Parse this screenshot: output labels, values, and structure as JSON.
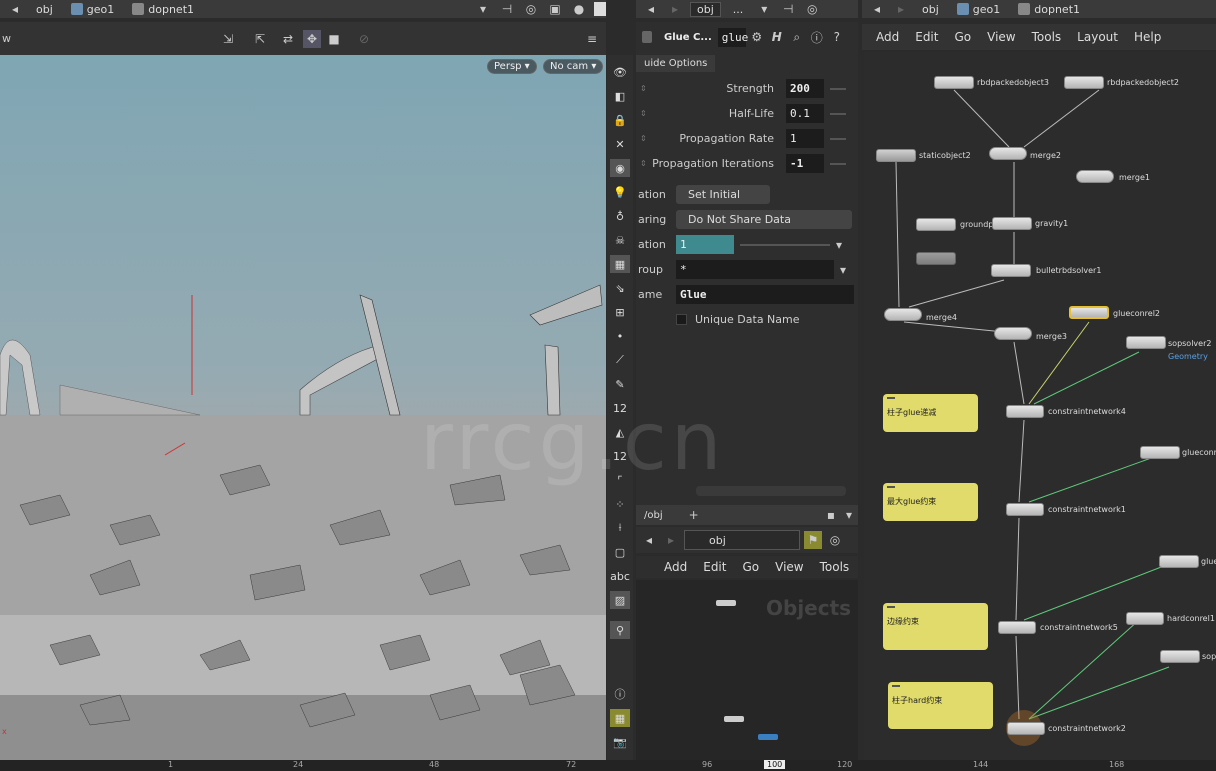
{
  "viewport_pane": {
    "path": [
      "obj",
      "geo1",
      "dopnet1"
    ],
    "camera_button": "Persp ▾",
    "cam_button": "No cam ▾",
    "side_toolbar_labels": [
      "12",
      "12",
      "abc"
    ]
  },
  "parm_pane": {
    "path": [
      "obj",
      "..."
    ],
    "node_type": "Glue C...",
    "node_name": "glue",
    "tab": "uide Options",
    "params": [
      {
        "label": "Strength",
        "value": "200"
      },
      {
        "label": "Half-Life",
        "value": "0.1"
      },
      {
        "label": "Propagation Rate",
        "value": "1"
      },
      {
        "label": "Propagation Iterations",
        "value": "-1"
      }
    ],
    "rows": [
      {
        "label": "ation",
        "value": "Set Initial"
      },
      {
        "label": "aring",
        "value": "Do Not Share Data"
      },
      {
        "label": "ation",
        "value": "1"
      },
      {
        "label": "roup",
        "value": "*"
      },
      {
        "label": "ame",
        "value": "Glue"
      }
    ],
    "unique_data_name": "Unique Data Name"
  },
  "obj_pane": {
    "tab": "/obj",
    "path": "obj",
    "menu": [
      "Add",
      "Edit",
      "Go",
      "View",
      "Tools"
    ],
    "watermark": "Objects"
  },
  "network_pane": {
    "path": [
      "obj",
      "geo1",
      "dopnet1"
    ],
    "menu": [
      "Add",
      "Edit",
      "Go",
      "View",
      "Tools",
      "Layout",
      "Help"
    ],
    "nodes": [
      {
        "name": "rbdpackedobject3"
      },
      {
        "name": "rbdpackedobject2"
      },
      {
        "name": "staticobject2"
      },
      {
        "name": "merge2"
      },
      {
        "name": "merge1"
      },
      {
        "name": "groundpl"
      },
      {
        "name": "gravity1"
      },
      {
        "name": "bulletrbdsolver1"
      },
      {
        "name": "merge4"
      },
      {
        "name": "merge3"
      },
      {
        "name": "glueconrel2"
      },
      {
        "name": "sopsolver2"
      },
      {
        "name": "constraintnetwork4"
      },
      {
        "name": "glueconre"
      },
      {
        "name": "constraintnetwork1"
      },
      {
        "name": "glue"
      },
      {
        "name": "hardconrel1"
      },
      {
        "name": "constraintnetwork5"
      },
      {
        "name": "sop"
      },
      {
        "name": "constraintnetwork2"
      }
    ],
    "sopsolver_sub": "Geometry",
    "stickies": [
      "柱子glue递减",
      "最大glue约束",
      "边缘约束",
      "柱子hard约束"
    ]
  },
  "timeline": {
    "ticks": [
      "1",
      "24",
      "48",
      "72",
      "96",
      "100",
      "120",
      "144",
      "168"
    ],
    "current_frame": "100"
  },
  "watermark_text": "rrcg.cn"
}
